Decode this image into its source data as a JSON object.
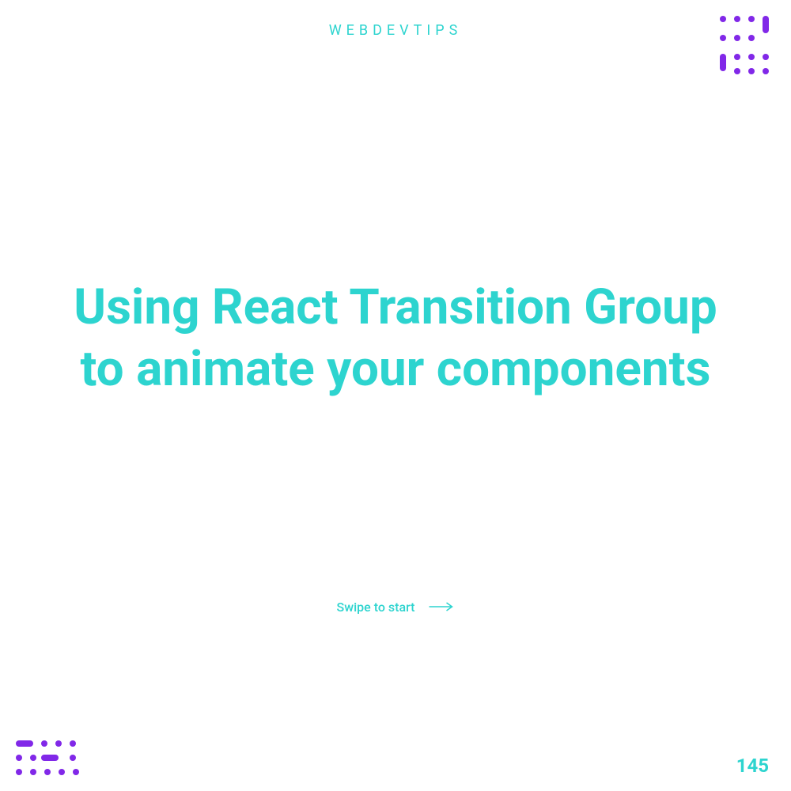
{
  "brand": "WEBDEVTIPS",
  "title": "Using React Transition Group to animate your components",
  "cta": "Swipe to start",
  "pageNumber": "145",
  "colors": {
    "teal": "#2dd4cf",
    "purple": "#8128e8"
  }
}
